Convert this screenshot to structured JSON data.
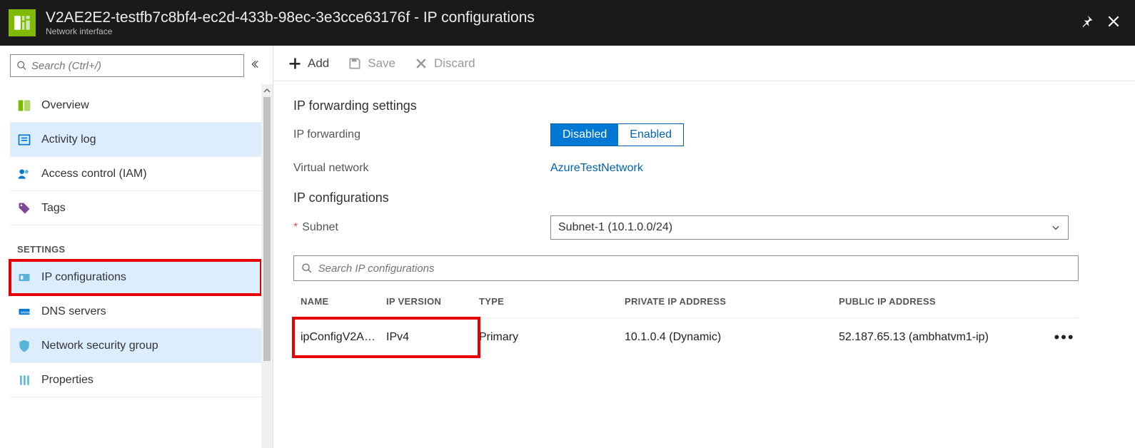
{
  "header": {
    "title": "V2AE2E2-testfb7c8bf4-ec2d-433b-98ec-3e3cce63176f - IP configurations",
    "subtitle": "Network interface"
  },
  "sidebar": {
    "search_placeholder": "Search (Ctrl+/)",
    "items": {
      "overview": "Overview",
      "activity_log": "Activity log",
      "iam": "Access control (IAM)",
      "tags": "Tags"
    },
    "section_settings": "SETTINGS",
    "settings": {
      "ip_configurations": "IP configurations",
      "dns_servers": "DNS servers",
      "nsg": "Network security group",
      "properties": "Properties"
    }
  },
  "toolbar": {
    "add": "Add",
    "save": "Save",
    "discard": "Discard"
  },
  "forwarding": {
    "heading": "IP forwarding settings",
    "label": "IP forwarding",
    "disabled": "Disabled",
    "enabled": "Enabled",
    "vnet_label": "Virtual network",
    "vnet_value": "AzureTestNetwork"
  },
  "ipconfig": {
    "heading": "IP configurations",
    "subnet_label": "Subnet",
    "subnet_value": "Subnet-1 (10.1.0.0/24)",
    "search_placeholder": "Search IP configurations",
    "columns": {
      "name": "NAME",
      "version": "IP VERSION",
      "type": "TYPE",
      "private": "PRIVATE IP ADDRESS",
      "public": "PUBLIC IP ADDRESS"
    },
    "rows": [
      {
        "name": "ipConfigV2A…",
        "version": "IPv4",
        "type": "Primary",
        "private": "10.1.0.4 (Dynamic)",
        "public": "52.187.65.13 (ambhatvm1-ip)"
      }
    ]
  }
}
